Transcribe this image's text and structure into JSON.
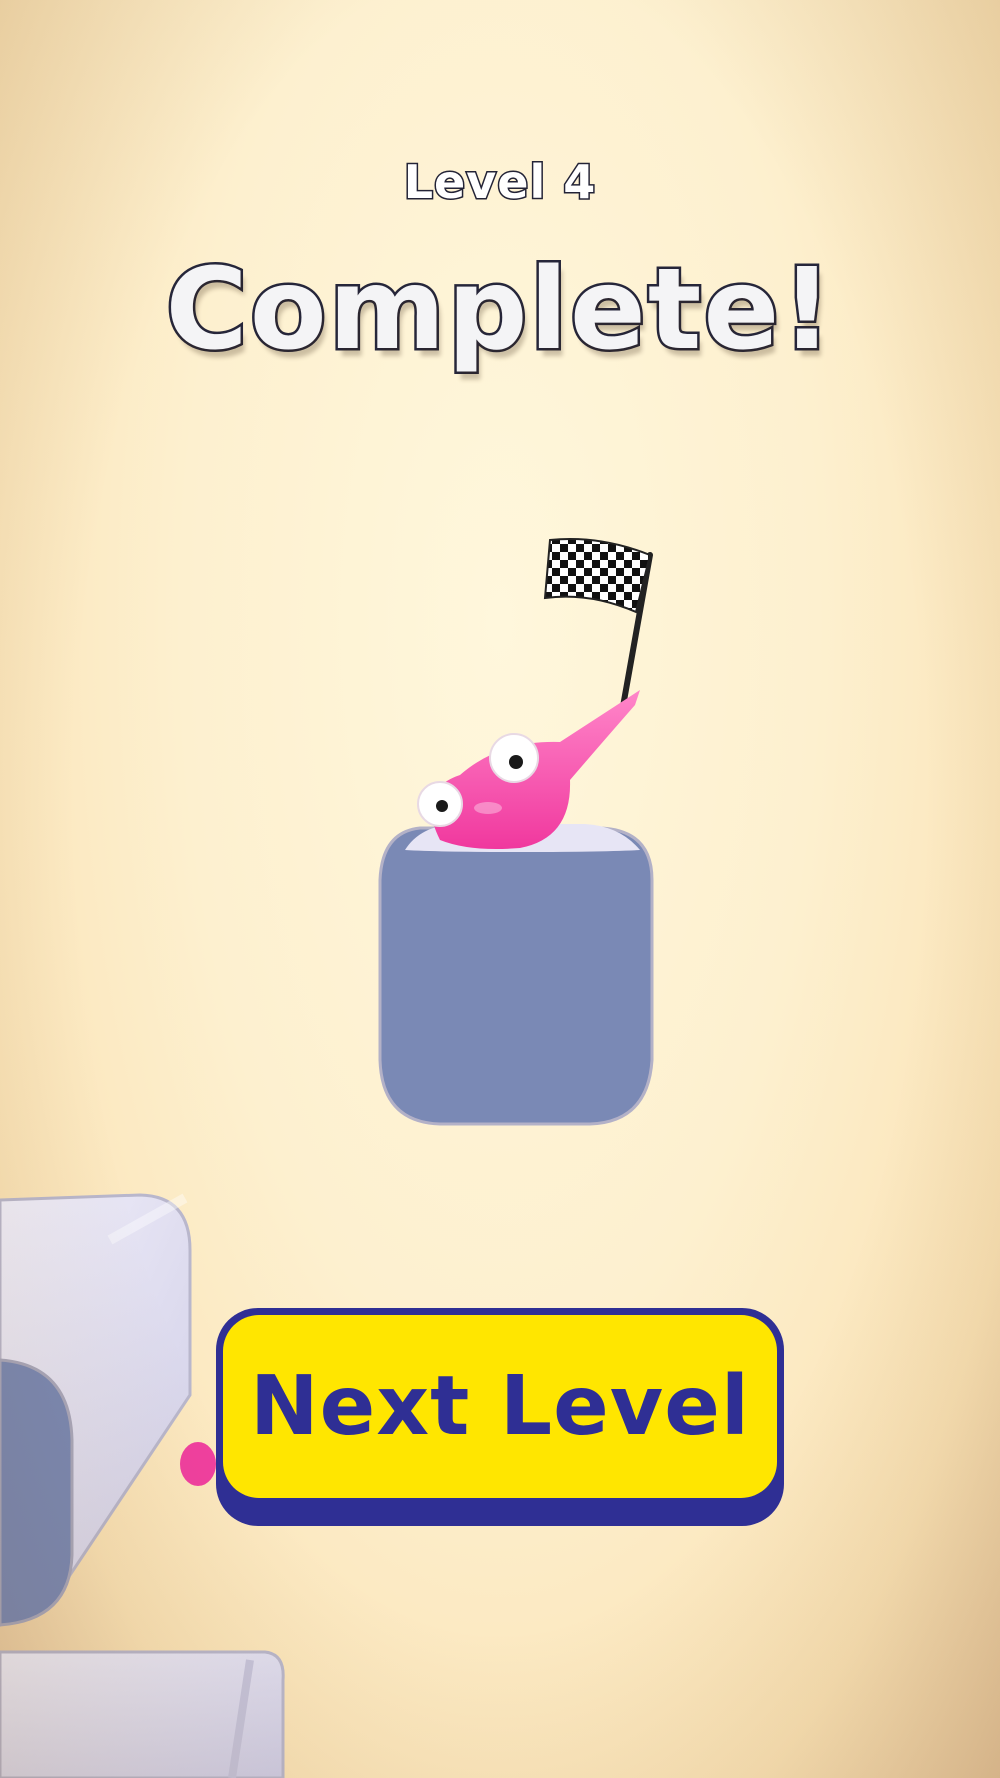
{
  "header": {
    "level_text": "Level 4",
    "status_text": "Complete!"
  },
  "actions": {
    "next_level_label": "Next Level"
  },
  "colors": {
    "button_face": "#ffe600",
    "button_rim": "#2f2f94",
    "character": "#ff5ab4",
    "block_front": "#7a89b5",
    "block_top": "#e6e4f4"
  },
  "icons": {
    "finish_flag": "checkered-flag-icon"
  }
}
